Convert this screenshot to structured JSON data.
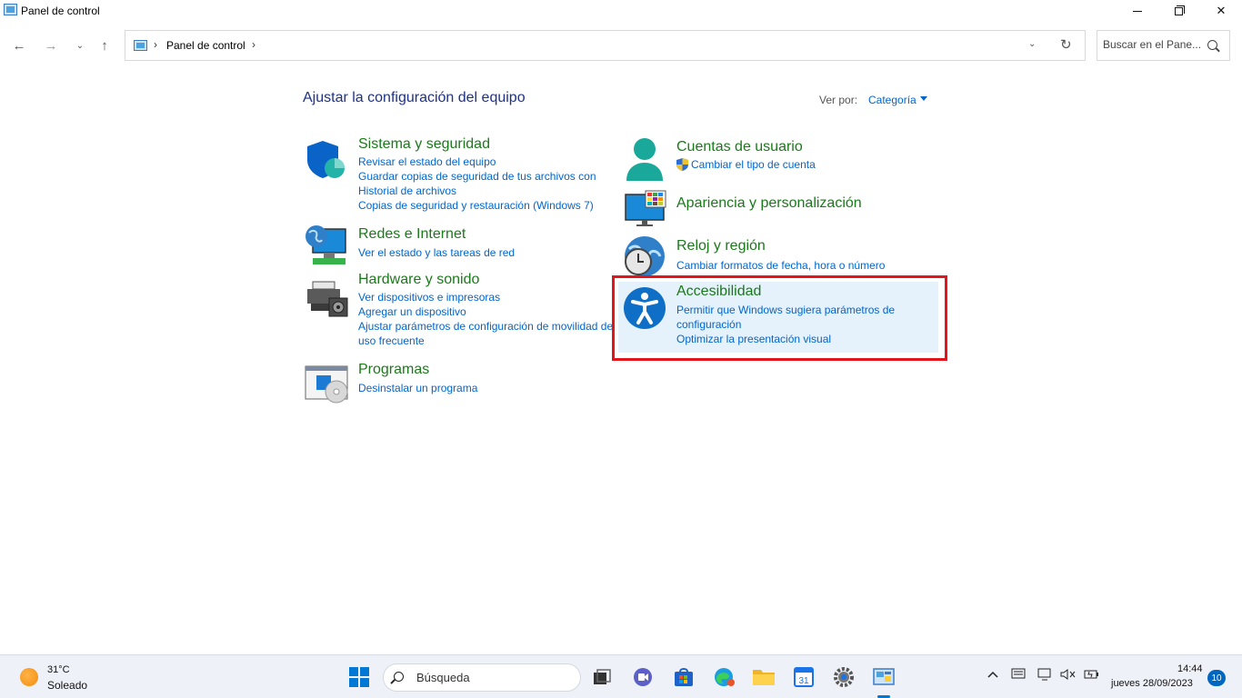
{
  "window": {
    "title": "Panel de control",
    "minimize": "—",
    "maximize": "❐",
    "close": "✕"
  },
  "nav": {
    "back": "←",
    "forward": "→",
    "recent": "⌄",
    "up": "↑",
    "breadcrumb_sep": "›",
    "breadcrumb": "Panel de control",
    "address_dropdown": "⌄",
    "refresh": "↻",
    "search_placeholder": "Buscar en el Pane..."
  },
  "header": {
    "title": "Ajustar la configuración del equipo",
    "view_by_label": "Ver por:",
    "view_by_value": "Categoría"
  },
  "categories": {
    "system": {
      "title": "Sistema y seguridad",
      "links": [
        "Revisar el estado del equipo",
        "Guardar copias de seguridad de tus archivos con Historial de archivos",
        "Copias de seguridad y restauración (Windows 7)"
      ]
    },
    "network": {
      "title": "Redes e Internet",
      "links": [
        "Ver el estado y las tareas de red"
      ]
    },
    "hardware": {
      "title": "Hardware y sonido",
      "links": [
        "Ver dispositivos e impresoras",
        "Agregar un dispositivo",
        "Ajustar parámetros de configuración de movilidad de uso frecuente"
      ]
    },
    "programs": {
      "title": "Programas",
      "links": [
        "Desinstalar un programa"
      ]
    },
    "accounts": {
      "title": "Cuentas de usuario",
      "links": [
        "Cambiar el tipo de cuenta"
      ]
    },
    "appearance": {
      "title": "Apariencia y personalización"
    },
    "clock": {
      "title": "Reloj y región",
      "links": [
        "Cambiar formatos de fecha, hora o número"
      ]
    },
    "accessibility": {
      "title": "Accesibilidad",
      "links": [
        "Permitir que Windows sugiera parámetros de configuración",
        "Optimizar la presentación visual"
      ]
    }
  },
  "taskbar": {
    "weather_temp": "31°C",
    "weather_cond": "Soleado",
    "search_label": "Búsqueda",
    "calendar_day": "31",
    "time": "14:44",
    "date": "jueves 28/09/2023",
    "notifications": "10"
  },
  "colors": {
    "accent": "#0078d4",
    "category_title": "#1a7a1a",
    "link": "#0066cc",
    "highlight_border": "#e3151a"
  }
}
